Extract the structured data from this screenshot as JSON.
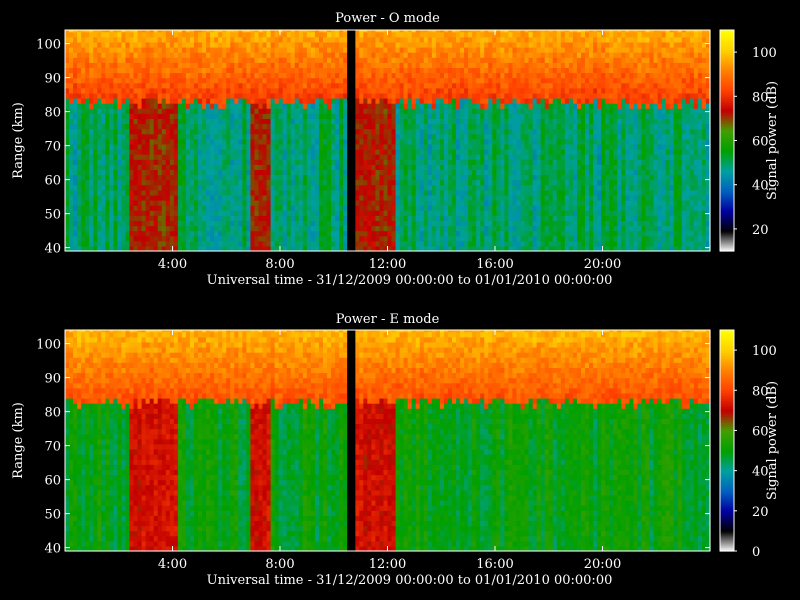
{
  "chart_data": [
    {
      "type": "heatmap",
      "title": "Power - O mode",
      "xlabel": "Universal time - 31/12/2009 00:00:00 to 01/01/2010 00:00:00",
      "ylabel": "Range (km)",
      "colorbar_label": "Signal power (dB)",
      "x_range_hours": [
        0,
        24
      ],
      "x_ticks": [
        4,
        8,
        12,
        16,
        20
      ],
      "x_tick_labels": [
        "4:00",
        "8:00",
        "12:00",
        "16:00",
        "20:00"
      ],
      "ylim": [
        39,
        104
      ],
      "y_ticks": [
        40,
        50,
        60,
        70,
        80,
        90,
        100
      ],
      "y_tick_labels": [
        "40",
        "50",
        "60",
        "70",
        "80",
        "90",
        "100"
      ],
      "color_range": [
        10,
        110
      ],
      "colorbar_ticks": [
        20,
        40,
        60,
        80,
        100
      ],
      "colorbar_tick_labels": [
        "20",
        "40",
        "60",
        "80",
        "100"
      ],
      "data_gap_hours": [
        10.5,
        10.8
      ],
      "layer_boundary_km": 82,
      "upper_layer_db": 82,
      "lower_layer_db": 50,
      "high_power_intervals_hours": [
        [
          2.4,
          4.2
        ],
        [
          6.8,
          7.6
        ],
        [
          10.8,
          12.3
        ]
      ]
    },
    {
      "type": "heatmap",
      "title": "Power - E mode",
      "xlabel": "Universal time - 31/12/2009 00:00:00 to 01/01/2010 00:00:00",
      "ylabel": "Range (km)",
      "colorbar_label": "Signal power (dB)",
      "x_range_hours": [
        0,
        24
      ],
      "x_ticks": [
        4,
        8,
        12,
        16,
        20
      ],
      "x_tick_labels": [
        "4:00",
        "8:00",
        "12:00",
        "16:00",
        "20:00"
      ],
      "ylim": [
        39,
        104
      ],
      "y_ticks": [
        40,
        50,
        60,
        70,
        80,
        90,
        100
      ],
      "y_tick_labels": [
        "40",
        "50",
        "60",
        "70",
        "80",
        "90",
        "100"
      ],
      "color_range": [
        0,
        110
      ],
      "colorbar_ticks": [
        0,
        20,
        40,
        60,
        80,
        100
      ],
      "colorbar_tick_labels": [
        "0",
        "20",
        "40",
        "60",
        "80",
        "100"
      ],
      "data_gap_hours": [
        10.5,
        10.8
      ],
      "layer_boundary_km": 82,
      "upper_layer_db": 82,
      "lower_layer_db": 50,
      "high_power_intervals_hours": [
        [
          2.4,
          4.2
        ],
        [
          6.8,
          7.6
        ],
        [
          10.8,
          12.3
        ]
      ]
    }
  ],
  "colormap": [
    "#ffffff",
    "#000000",
    "#0000a0",
    "#0060c0",
    "#00a0a0",
    "#00a000",
    "#40a000",
    "#c00000",
    "#ff4000",
    "#ff8000",
    "#ffd000",
    "#ffff00"
  ]
}
